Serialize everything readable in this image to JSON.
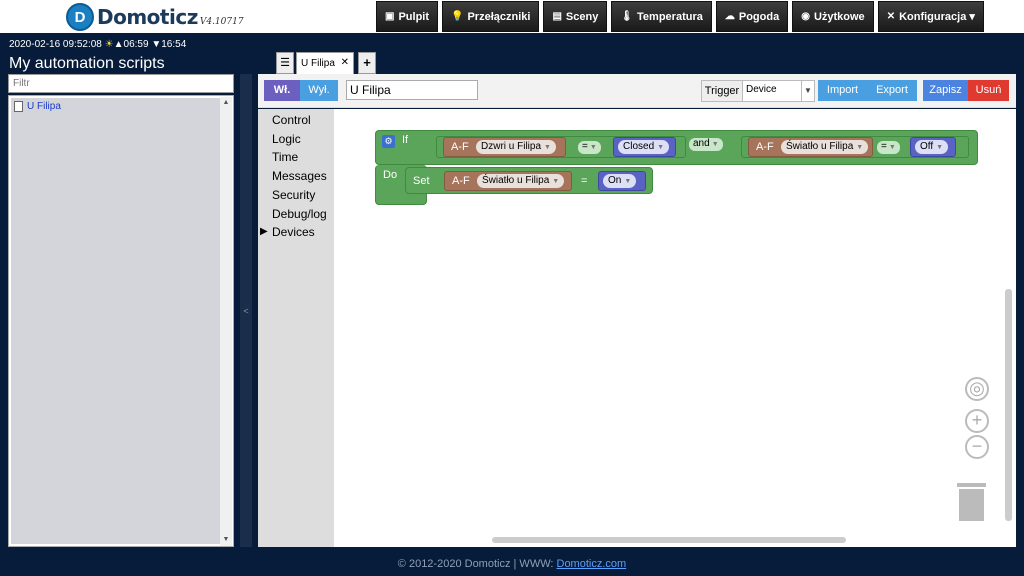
{
  "app": {
    "name": "Domoticz",
    "version": "V4.10717"
  },
  "nav": [
    {
      "icon": "monitor-icon",
      "glyph": "▣",
      "label": "Pulpit"
    },
    {
      "icon": "bulb-icon",
      "glyph": "💡",
      "label": "Przełączniki"
    },
    {
      "icon": "scene-icon",
      "glyph": "▤",
      "label": "Sceny"
    },
    {
      "icon": "thermometer-icon",
      "glyph": "🌡",
      "label": "Temperatura"
    },
    {
      "icon": "weather-icon",
      "glyph": "☁",
      "label": "Pogoda"
    },
    {
      "icon": "utility-icon",
      "glyph": "◉",
      "label": "Użytkowe"
    },
    {
      "icon": "tools-icon",
      "glyph": "✕",
      "label": "Konfiguracja ▾"
    }
  ],
  "status": {
    "datetime": "2020-02-16 09:52:08",
    "sunrise": "06:59",
    "sunset": "16:54"
  },
  "page_title": "My automation scripts",
  "filter": {
    "placeholder": "Filtr"
  },
  "scripts": [
    {
      "name": "U Filipa"
    }
  ],
  "collapse_glyph": "<",
  "tabs": {
    "menu_glyph": "☰",
    "active": "U Filipa",
    "close_glyph": "✕",
    "add_glyph": "+"
  },
  "toolbar": {
    "on_label": "Wł.",
    "off_label": "Wył.",
    "script_name": "U Filipa",
    "trigger_label": "Trigger",
    "trigger_value": "Device",
    "import_label": "Import",
    "export_label": "Export",
    "save_label": "Zapisz",
    "delete_label": "Usuń"
  },
  "categories": [
    "Control",
    "Logic",
    "Time",
    "Messages",
    "Security",
    "Debug/log",
    "Devices"
  ],
  "blocks": {
    "if_kw": "If",
    "do_kw": "Do",
    "set_kw": "Set",
    "and_kw": "and",
    "af": "A-F",
    "cond1_device": "Dzwri u Filipa",
    "cond1_op": "=",
    "cond1_value": "Closed",
    "cond2_device": "Światło u Filipa",
    "cond2_op": "=",
    "cond2_value": "Off",
    "set_device": "Światło u Filipa",
    "set_op": "=",
    "set_value": "On"
  },
  "footer": {
    "text": "© 2012-2020 Domoticz | WWW: ",
    "link": "Domoticz.com"
  }
}
